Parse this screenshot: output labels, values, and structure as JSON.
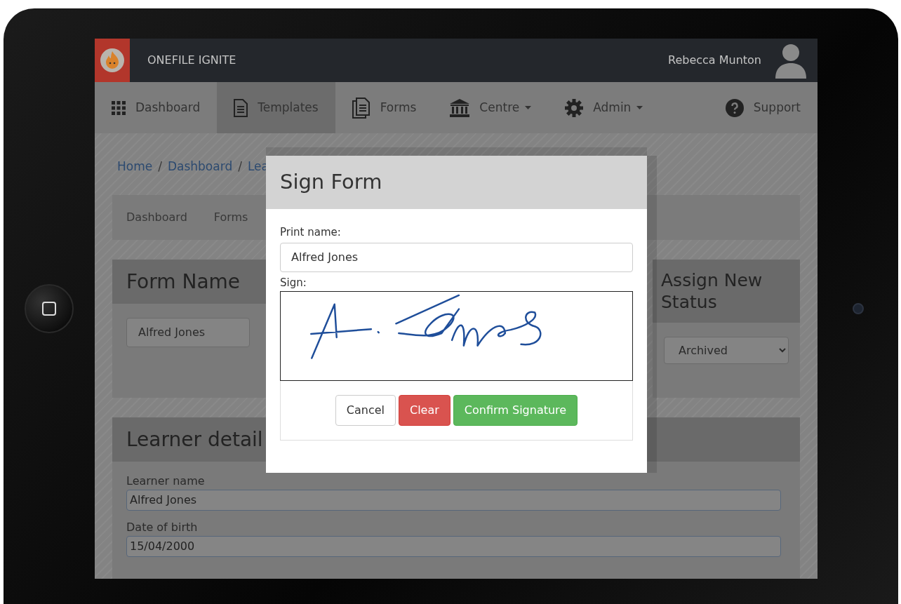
{
  "app": {
    "logo_text": "ONEFILE IGNITE",
    "user_name": "Rebecca Munton"
  },
  "nav": [
    {
      "label": "Dashboard",
      "kind": "grid",
      "selected": false,
      "dropdown": false
    },
    {
      "label": "Templates",
      "kind": "document",
      "selected": true,
      "dropdown": false
    },
    {
      "label": "Forms",
      "kind": "documents",
      "selected": false,
      "dropdown": false
    },
    {
      "label": "Centre",
      "kind": "building",
      "selected": false,
      "dropdown": true
    },
    {
      "label": "Admin",
      "kind": "gear",
      "selected": false,
      "dropdown": true
    },
    {
      "label": "Support",
      "kind": "help",
      "selected": false,
      "dropdown": false
    }
  ],
  "breadcrumb": [
    "Home",
    "Dashboard",
    "Lea"
  ],
  "breadcrumb_separator": "/",
  "subnav": [
    "Dashboard",
    "Forms"
  ],
  "form_name_panel": {
    "title": "Form Name",
    "value": "Alfred Jones"
  },
  "status_panel": {
    "title": "Assign New Status",
    "value": "Archived"
  },
  "learner_panel": {
    "title": "Learner detail",
    "fields": [
      {
        "label": "Learner name",
        "value": "Alfred Jones"
      },
      {
        "label": "Date of birth",
        "value": "15/04/2000"
      }
    ]
  },
  "modal": {
    "title": "Sign Form",
    "print_name_label": "Print name:",
    "print_name_value": "Alfred Jones",
    "sign_label": "Sign:",
    "buttons": [
      {
        "label": "Cancel",
        "kind": "default"
      },
      {
        "label": "Clear",
        "kind": "danger"
      },
      {
        "label": "Confirm Signature",
        "kind": "success"
      }
    ]
  }
}
